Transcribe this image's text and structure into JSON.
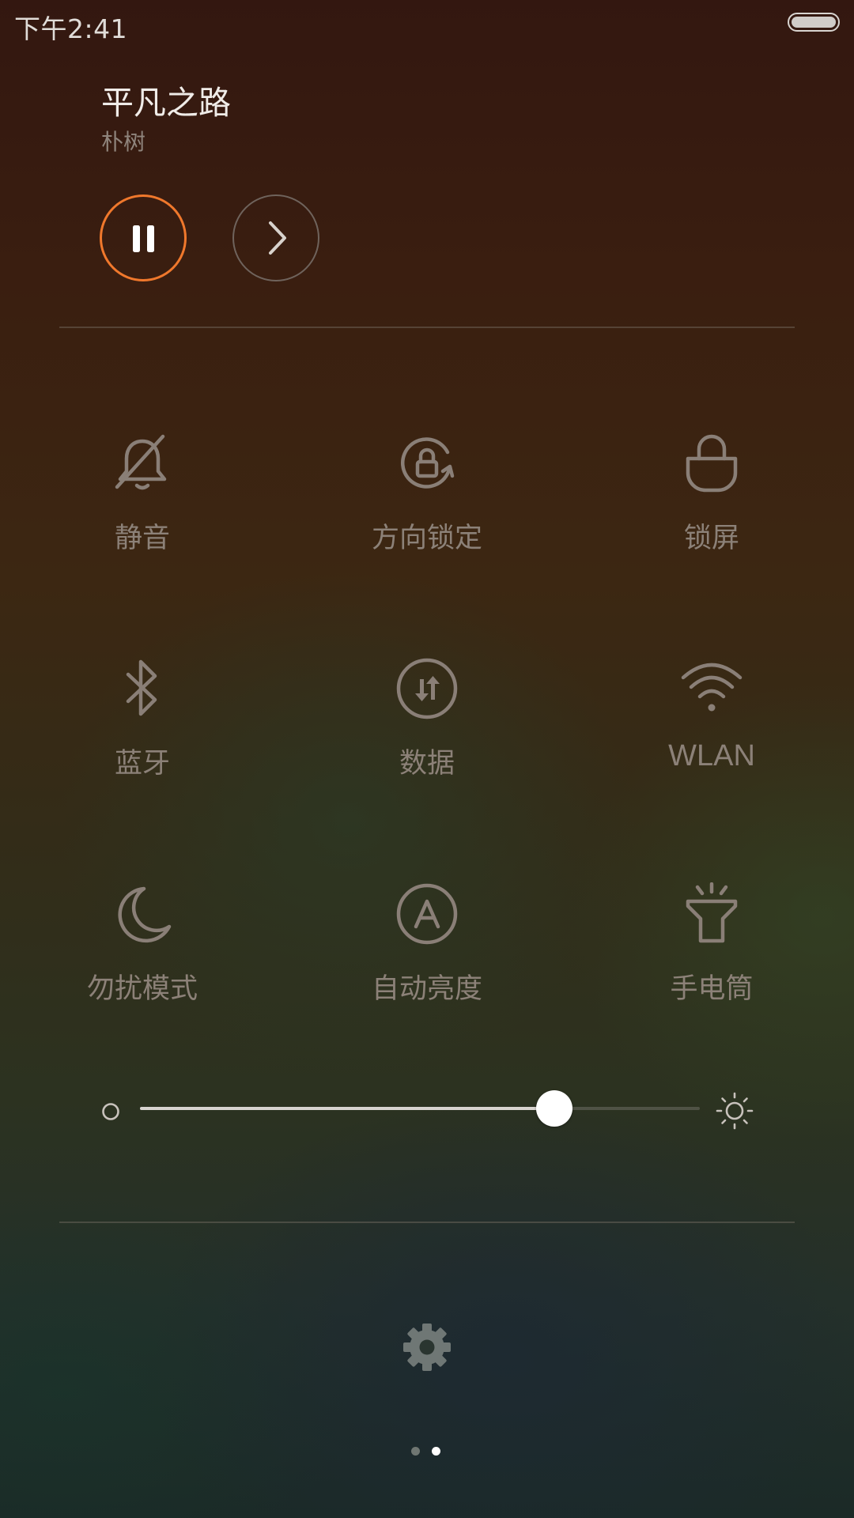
{
  "status_bar": {
    "time": "下午2:41",
    "battery_icon": "battery-icon"
  },
  "music": {
    "title": "平凡之路",
    "artist": "朴树",
    "accent_color": "#f0782c",
    "pause_icon": "pause-icon",
    "next_icon": "chevron-right-icon"
  },
  "toggles": [
    {
      "label": "静音",
      "icon": "bell-off-icon"
    },
    {
      "label": "方向锁定",
      "icon": "rotation-lock-icon"
    },
    {
      "label": "锁屏",
      "icon": "lock-icon"
    },
    {
      "label": "蓝牙",
      "icon": "bluetooth-icon"
    },
    {
      "label": "数据",
      "icon": "mobile-data-icon"
    },
    {
      "label": "WLAN",
      "icon": "wifi-icon"
    },
    {
      "label": "勿扰模式",
      "icon": "moon-icon"
    },
    {
      "label": "自动亮度",
      "icon": "auto-brightness-icon"
    },
    {
      "label": "手电筒",
      "icon": "flashlight-icon"
    }
  ],
  "brightness": {
    "level": 0.74,
    "low_icon": "brightness-low-icon",
    "high_icon": "brightness-high-icon"
  },
  "settings": {
    "icon": "gear-icon"
  },
  "pager": {
    "page_count": 2,
    "current_page": 2
  }
}
